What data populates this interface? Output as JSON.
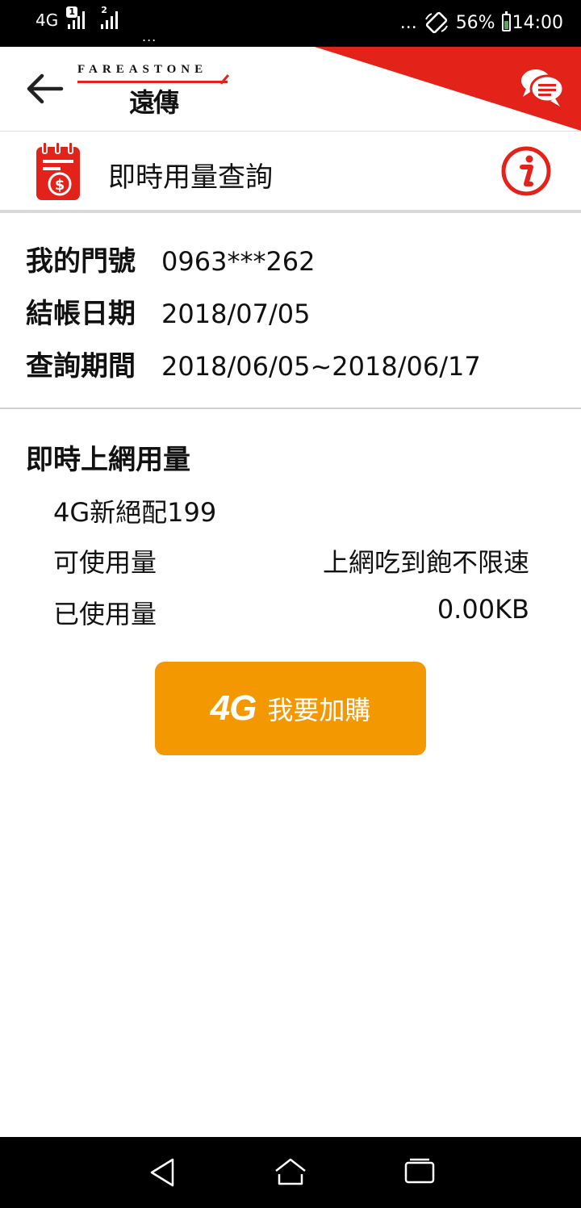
{
  "status_bar": {
    "network": "4G",
    "sim1_badge": "1",
    "sim2_badge": "2",
    "overflow": "...",
    "right_overflow": "...",
    "battery": "56%",
    "time": "14:00"
  },
  "header": {
    "logo_en": "FAREASTONE",
    "logo_zh": "遠傳"
  },
  "page": {
    "title": "即時用量查詢"
  },
  "account": {
    "rows": [
      {
        "label": "我的門號",
        "value": "0963***262"
      },
      {
        "label": "結帳日期",
        "value": "2018/07/05"
      },
      {
        "label": "查詢期間",
        "value": "2018/06/05~2018/06/17"
      }
    ]
  },
  "usage": {
    "section_title": "即時上網用量",
    "plan_name": "4G新絕配199",
    "available_label": "可使用量",
    "available_value": "上網吃到飽不限速",
    "used_label": "已使用量",
    "used_value": "0.00KB"
  },
  "purchase_button": {
    "badge": "4G",
    "label": "我要加購"
  },
  "colors": {
    "brand_red": "#e32219",
    "button_orange": "#f39800"
  },
  "icons": [
    "back-arrow-icon",
    "chat-bubble-icon",
    "bill-dollar-icon",
    "info-icon",
    "nav-back-icon",
    "nav-home-icon",
    "nav-recents-icon"
  ]
}
